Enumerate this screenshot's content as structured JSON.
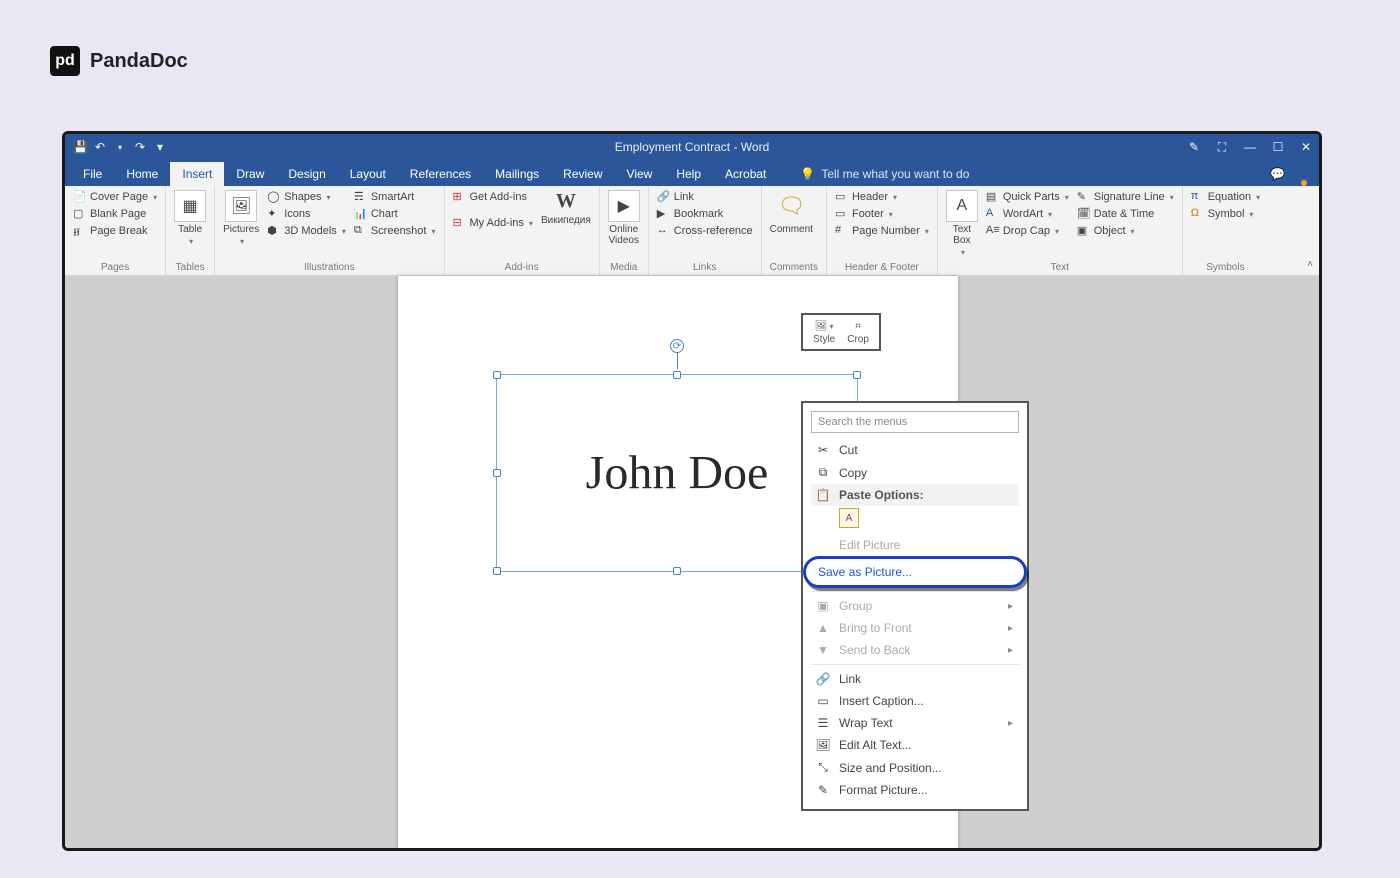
{
  "brand": {
    "name": "PandaDoc"
  },
  "window_title": "Employment Contract - Word",
  "tabs": {
    "file": "File",
    "home": "Home",
    "insert": "Insert",
    "draw": "Draw",
    "design": "Design",
    "layout": "Layout",
    "references": "References",
    "mailings": "Mailings",
    "review": "Review",
    "view": "View",
    "help": "Help",
    "acrobat": "Acrobat",
    "tellme": "Tell me what you want to do"
  },
  "ribbon": {
    "pages": {
      "label": "Pages",
      "cover_page": "Cover Page",
      "blank_page": "Blank Page",
      "page_break": "Page Break"
    },
    "tables": {
      "label": "Tables",
      "table": "Table"
    },
    "illustrations": {
      "label": "Illustrations",
      "pictures": "Pictures",
      "shapes": "Shapes",
      "icons": "Icons",
      "models": "3D Models",
      "smartart": "SmartArt",
      "chart": "Chart",
      "screenshot": "Screenshot"
    },
    "addins": {
      "label": "Add-ins",
      "get": "Get Add-ins",
      "my": "My Add-ins",
      "wikipedia": "Википедия"
    },
    "media": {
      "label": "Media",
      "online_videos": "Online\nVideos"
    },
    "links": {
      "label": "Links",
      "link": "Link",
      "bookmark": "Bookmark",
      "crossref": "Cross-reference"
    },
    "comments": {
      "label": "Comments",
      "comment": "Comment"
    },
    "headerfooter": {
      "label": "Header & Footer",
      "header": "Header",
      "footer": "Footer",
      "page_number": "Page Number"
    },
    "text": {
      "label": "Text",
      "textbox": "Text\nBox",
      "quick_parts": "Quick Parts",
      "wordart": "WordArt",
      "drop_cap": "Drop Cap",
      "sig_line": "Signature Line",
      "date_time": "Date & Time",
      "object": "Object"
    },
    "symbols": {
      "label": "Symbols",
      "equation": "Equation",
      "symbol": "Symbol"
    }
  },
  "document": {
    "signature_text": "John Doe"
  },
  "mini_toolbar": {
    "style": "Style",
    "crop": "Crop"
  },
  "context_menu": {
    "search_placeholder": "Search the menus",
    "cut": "Cut",
    "copy": "Copy",
    "paste_options": "Paste Options:",
    "edit_picture": "Edit Picture",
    "save_as_picture": "Save as Picture...",
    "group": "Group",
    "bring_front": "Bring to Front",
    "send_back": "Send to Back",
    "link": "Link",
    "insert_caption": "Insert Caption...",
    "wrap_text": "Wrap Text",
    "edit_alt_text": "Edit Alt Text...",
    "size_position": "Size and Position...",
    "format_picture": "Format Picture..."
  }
}
